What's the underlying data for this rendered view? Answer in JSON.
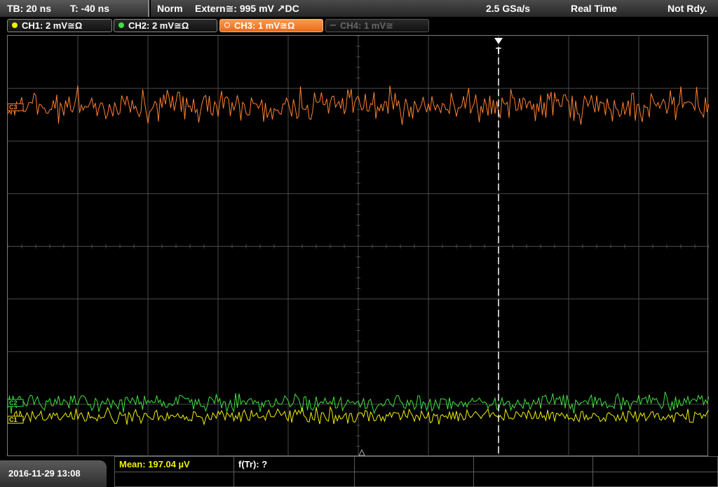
{
  "header": {
    "timebase": "TB: 20 ns",
    "trigger_time": "T: -40 ns",
    "trigger_mode": "Norm",
    "trigger_source": "Extern≅: 995 mV ↗DC",
    "sample_rate": "2.5 GSa/s",
    "acq_mode": "Real Time",
    "status": "Not Rdy."
  },
  "channels": [
    {
      "label": "CH1: 2 mV≅Ω",
      "color": "#f0f000",
      "state": "on"
    },
    {
      "label": "CH2: 2 mV≅Ω",
      "color": "#40e040",
      "state": "on"
    },
    {
      "label": "CH3: 1 mV≅Ω",
      "color": "#ff8030",
      "state": "active"
    },
    {
      "label": "CH4: 1 mV≅",
      "color": "#666666",
      "state": "off"
    }
  ],
  "markers": {
    "ch3": "C3",
    "ch2": "C2",
    "ch1": "C1",
    "trigger": "T"
  },
  "footer": {
    "datetime": "2016-11-29 13:08",
    "mean": "Mean: 197.04 µV",
    "freq": "f(Tr): ?"
  },
  "colors": {
    "grid": "#4a4a4a",
    "trigger_line": "#ffffff"
  }
}
